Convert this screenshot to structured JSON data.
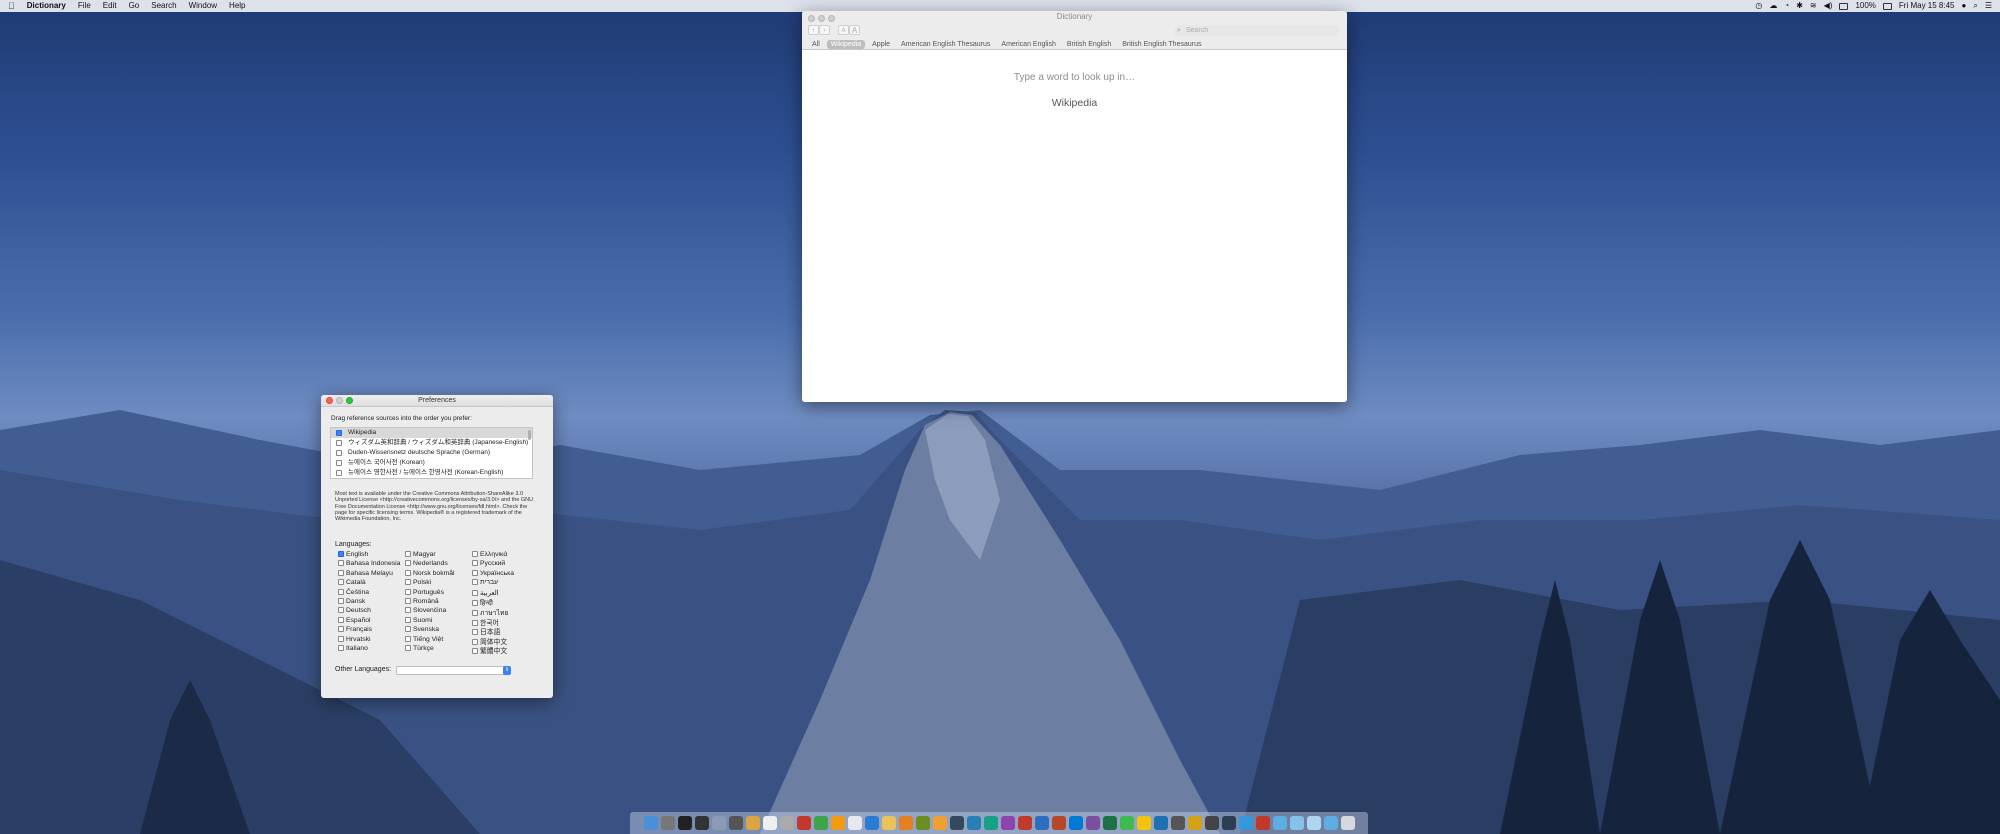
{
  "menubar": {
    "apple": "",
    "app": "Dictionary",
    "items": [
      "File",
      "Edit",
      "Go",
      "Search",
      "Window",
      "Help"
    ],
    "battery": "100%",
    "clock": "Fri May 15  8:45"
  },
  "dictionary_window": {
    "title": "Dictionary",
    "back": "‹",
    "forward": "›",
    "font_smaller": "A",
    "font_larger": "A",
    "search_placeholder": "Search",
    "tabs": [
      "All",
      "Wikipedia",
      "Apple",
      "American English Thesaurus",
      "American English",
      "British English",
      "British English Thesaurus"
    ],
    "active_tab": "Wikipedia",
    "prompt": "Type a word to look up in…",
    "source": "Wikipedia"
  },
  "preferences_window": {
    "title": "Preferences",
    "instruction": "Drag reference sources into the order you prefer:",
    "sources": [
      {
        "label": "Wikipedia",
        "checked": true
      },
      {
        "label": "ウィズダム英和辞典 / ウィズダム和英辞典 (Japanese-English)",
        "checked": false
      },
      {
        "label": "Duden-Wissensnetz deutsche Sprache (German)",
        "checked": false
      },
      {
        "label": "뉴에이스 국어사전 (Korean)",
        "checked": false
      },
      {
        "label": "뉴에이스 영한사전 / 뉴에이스 한영사전 (Korean-English)",
        "checked": false
      }
    ],
    "info_text": "Most text is available under the Creative Commons Attribution-ShareAlike 3.0 Unported License <http://creativecommons.org/licenses/by-sa/3.0/> and the GNU Free Documentation License <http://www.gnu.org/licenses/fdl.html>. Check the page for specific licensing terms. Wikipedia® is a registered trademark of the Wikimedia Foundation, Inc.",
    "languages_label": "Languages:",
    "languages_col1": [
      {
        "label": "English",
        "checked": true
      },
      {
        "label": "Bahasa Indonesia",
        "checked": false
      },
      {
        "label": "Bahasa Melayu",
        "checked": false
      },
      {
        "label": "Català",
        "checked": false
      },
      {
        "label": "Čeština",
        "checked": false
      },
      {
        "label": "Dansk",
        "checked": false
      },
      {
        "label": "Deutsch",
        "checked": false
      },
      {
        "label": "Español",
        "checked": false
      },
      {
        "label": "Français",
        "checked": false
      },
      {
        "label": "Hrvatski",
        "checked": false
      },
      {
        "label": "Italiano",
        "checked": false
      }
    ],
    "languages_col2": [
      {
        "label": "Magyar",
        "checked": false
      },
      {
        "label": "Nederlands",
        "checked": false
      },
      {
        "label": "Norsk bokmål",
        "checked": false
      },
      {
        "label": "Polski",
        "checked": false
      },
      {
        "label": "Português",
        "checked": false
      },
      {
        "label": "Română",
        "checked": false
      },
      {
        "label": "Slovenčina",
        "checked": false
      },
      {
        "label": "Suomi",
        "checked": false
      },
      {
        "label": "Svenska",
        "checked": false
      },
      {
        "label": "Tiếng Việt",
        "checked": false
      },
      {
        "label": "Türkçe",
        "checked": false
      }
    ],
    "languages_col3": [
      {
        "label": "Ελληνικά",
        "checked": false
      },
      {
        "label": "Русский",
        "checked": false
      },
      {
        "label": "Українська",
        "checked": false
      },
      {
        "label": "עברית",
        "checked": false
      },
      {
        "label": "العربية",
        "checked": false
      },
      {
        "label": "हिन्दी",
        "checked": false
      },
      {
        "label": "ภาษาไทย",
        "checked": false
      },
      {
        "label": "한국어",
        "checked": false
      },
      {
        "label": "日本語",
        "checked": false
      },
      {
        "label": "简体中文",
        "checked": false
      },
      {
        "label": "繁體中文",
        "checked": false
      }
    ],
    "other_languages_label": "Other Languages:",
    "other_languages_value": ""
  },
  "colors": {
    "accent": "#3b82f6",
    "close": "#fc5f57",
    "minimize": "#fdbc2e",
    "zoom": "#28c840"
  }
}
